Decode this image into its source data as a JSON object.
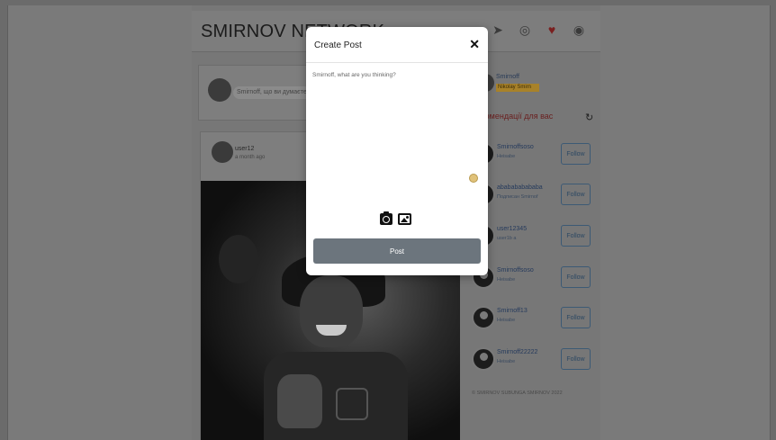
{
  "navbar": {
    "brand": "SMIRNOV NETWORK",
    "icons": [
      "home-icon",
      "send-icon",
      "compass-icon",
      "heart-icon",
      "avatar-icon"
    ]
  },
  "composer": {
    "placeholder": "Smirnoff, що ви думаєте?"
  },
  "post": {
    "username": "user12",
    "time": "a month ago"
  },
  "sidebar": {
    "me": {
      "name": "Smirnoff",
      "badge": "Nikolay Smirn"
    },
    "recommendations_title": "Рекомендації для вас",
    "suggestions": [
      {
        "name": "Smirnoffsoso",
        "sub": "Heisabe",
        "follow": "Follow"
      },
      {
        "name": "ababababababa",
        "sub": "Подписан Smirnof",
        "follow": "Follow"
      },
      {
        "name": "user12345",
        "sub": "user1b a",
        "follow": "Follow"
      },
      {
        "name": "Smirnoffsoso",
        "sub": "Heisabe",
        "follow": "Follow"
      },
      {
        "name": "Smirnoff13",
        "sub": "Heisabe",
        "follow": "Follow"
      },
      {
        "name": "Smirnoff22222",
        "sub": "Heisabe",
        "follow": "Follow"
      }
    ],
    "footer": "© SMIRNOV SUBUNGA SMIRNOV 2022"
  },
  "modal": {
    "title": "Create Post",
    "close": "✕",
    "placeholder": "Smirnoff, what are you thinking?",
    "post_label": "Post"
  }
}
